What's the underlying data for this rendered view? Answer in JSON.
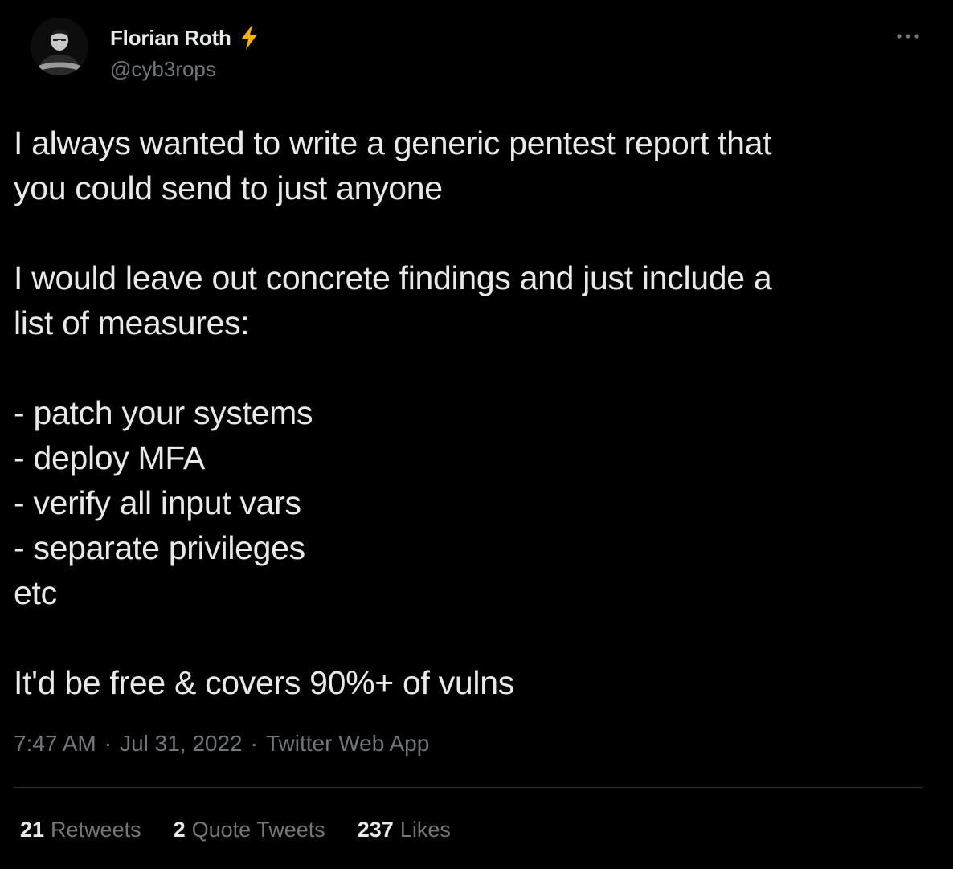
{
  "author": {
    "display_name": "Florian Roth",
    "handle": "@cyb3rops",
    "badge_icon": "lightning-bolt-icon",
    "badge_color": "#f4b400"
  },
  "tweet": {
    "text": "I always wanted to write a generic pentest report that\nyou could send to just anyone\n\nI would leave out concrete findings and just include a\nlist of measures:\n\n- patch your systems\n- deploy MFA\n- verify all input vars\n- separate privileges\netc\n\nIt'd be free & covers 90%+ of vulns"
  },
  "meta": {
    "time": "7:47 AM",
    "separator": "·",
    "date": "Jul 31, 2022",
    "source": "Twitter Web App"
  },
  "stats": {
    "retweets": {
      "count": "21",
      "label": "Retweets"
    },
    "quote_tweets": {
      "count": "2",
      "label": "Quote Tweets"
    },
    "likes": {
      "count": "237",
      "label": "Likes"
    }
  },
  "colors": {
    "background": "#000000",
    "primary_text": "#e7e9ea",
    "secondary_text": "#71767b",
    "divider": "#2f3336"
  }
}
